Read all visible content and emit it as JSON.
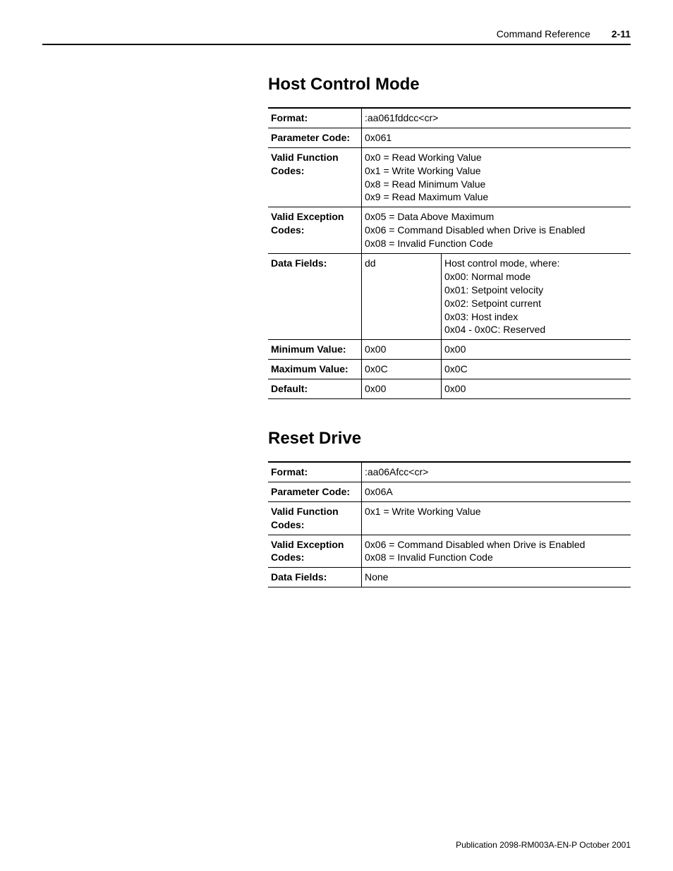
{
  "header": {
    "section": "Command Reference",
    "page": "2-11"
  },
  "sections": [
    {
      "title": "Host Control Mode",
      "rows": [
        {
          "label": "Format:",
          "c1": ":aa061fddcc<cr>",
          "c2": ""
        },
        {
          "label": "Parameter Code:",
          "c1": "0x061",
          "c2": ""
        },
        {
          "label": "Valid Function Codes:",
          "c1": "0x0 = Read Working Value\n0x1 = Write Working Value\n0x8 = Read Minimum Value\n0x9 = Read Maximum Value",
          "c2": ""
        },
        {
          "label": "Valid Exception Codes:",
          "c1": "0x05 = Data Above Maximum\n0x06 = Command Disabled when Drive is Enabled\n0x08 = Invalid Function Code",
          "c2": ""
        },
        {
          "label": "Data Fields:",
          "c1": "dd",
          "c2": "Host control mode, where:\n0x00: Normal mode\n0x01: Setpoint velocity\n0x02: Setpoint current\n0x03: Host index\n0x04 - 0x0C: Reserved",
          "split": true
        },
        {
          "label": "Minimum Value:",
          "c1": "0x00",
          "c2": "0x00",
          "split": true
        },
        {
          "label": "Maximum Value:",
          "c1": "0x0C",
          "c2": "0x0C",
          "split": true
        },
        {
          "label": "Default:",
          "c1": "0x00",
          "c2": "0x00",
          "split": true
        }
      ]
    },
    {
      "title": "Reset Drive",
      "rows": [
        {
          "label": "Format:",
          "c1": ":aa06Afcc<cr>",
          "c2": ""
        },
        {
          "label": "Parameter Code:",
          "c1": "0x06A",
          "c2": ""
        },
        {
          "label": "Valid Function Codes:",
          "c1": "0x1 = Write Working Value",
          "c2": ""
        },
        {
          "label": "Valid Exception Codes:",
          "c1": "0x06 = Command Disabled when Drive is Enabled\n0x08 = Invalid Function Code",
          "c2": ""
        },
        {
          "label": "Data Fields:",
          "c1": "None",
          "c2": ""
        }
      ]
    }
  ],
  "footer": "Publication 2098-RM003A-EN-P October 2001"
}
